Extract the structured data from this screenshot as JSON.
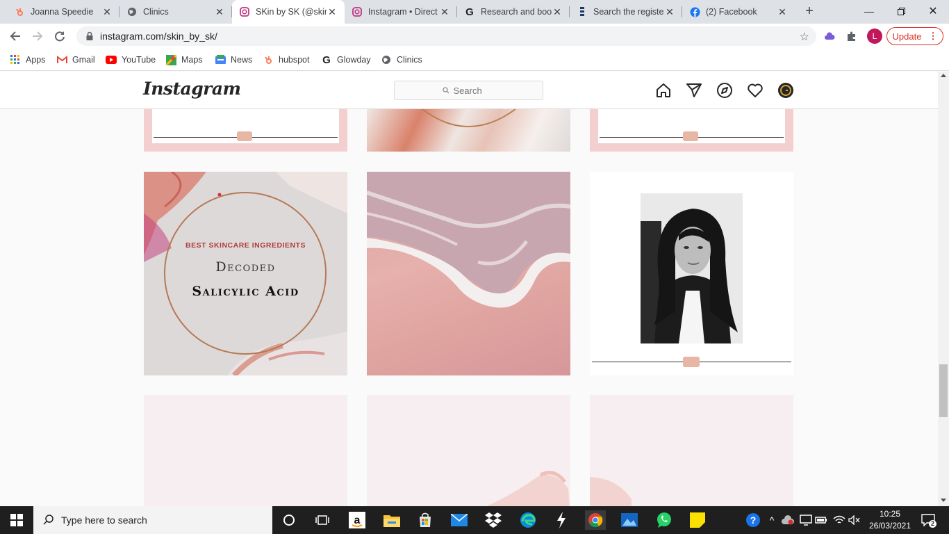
{
  "browser": {
    "tabs": [
      {
        "title": "Joanna Speedie",
        "icon": "hubspot-icon"
      },
      {
        "title": "Clinics",
        "icon": "globe-icon"
      },
      {
        "title": "SKin by SK (@skin_",
        "icon": "instagram-icon",
        "active": true
      },
      {
        "title": "Instagram • Direct",
        "icon": "instagram-icon"
      },
      {
        "title": "Research and boo",
        "icon": "g-icon"
      },
      {
        "title": "Search the registe",
        "icon": "register-icon"
      },
      {
        "title": "(2) Facebook",
        "icon": "facebook-icon"
      }
    ],
    "address": "instagram.com/skin_by_sk/",
    "profile_initial": "L",
    "update_label": "Update",
    "bookmarks": [
      {
        "label": "Apps",
        "icon": "apps-grid-icon"
      },
      {
        "label": "Gmail",
        "icon": "gmail-icon"
      },
      {
        "label": "YouTube",
        "icon": "youtube-icon"
      },
      {
        "label": "Maps",
        "icon": "maps-icon"
      },
      {
        "label": "News",
        "icon": "news-icon"
      },
      {
        "label": "hubspot",
        "icon": "hubspot-icon"
      },
      {
        "label": "Glowday",
        "icon": "g-icon"
      },
      {
        "label": "Clinics",
        "icon": "globe-icon"
      }
    ]
  },
  "instagram": {
    "logo": "Instagram",
    "search_placeholder": "Search",
    "nav_icons": [
      "home-icon",
      "direct-icon",
      "explore-icon",
      "activity-heart-icon",
      "profile-avatar"
    ],
    "posts": {
      "salicylic": {
        "kicker": "BEST SKINCARE INGREDIENTS",
        "line1": "Decoded",
        "line2": "Salicylic Acid"
      }
    }
  },
  "taskbar": {
    "search_placeholder": "Type here to search",
    "time": "10:25",
    "date": "26/03/2021",
    "notification_count": "2"
  },
  "colors": {
    "accent_pink": "#f4cfcf",
    "instagram_text": "#262626",
    "update_red": "#d93025"
  }
}
